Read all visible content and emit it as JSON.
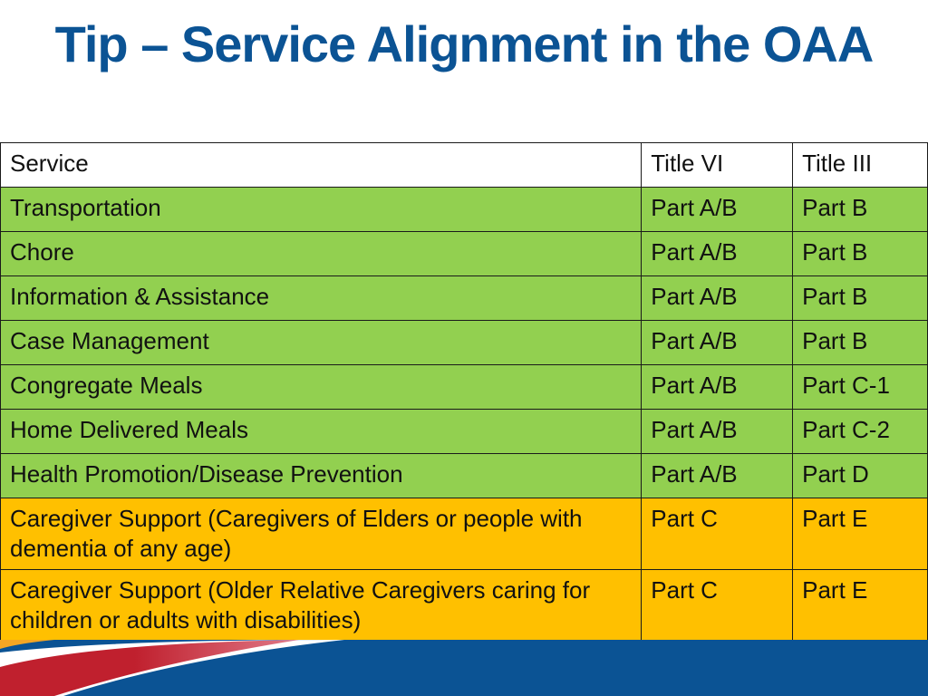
{
  "title": "Tip – Service Alignment in the OAA",
  "table": {
    "headers": [
      "Service",
      "Title VI",
      "Title III"
    ],
    "rows": [
      {
        "service": "Transportation",
        "title_vi": "Part A/B",
        "title_iii": "Part B",
        "color": "green"
      },
      {
        "service": "Chore",
        "title_vi": "Part A/B",
        "title_iii": "Part B",
        "color": "green"
      },
      {
        "service": "Information & Assistance",
        "title_vi": "Part A/B",
        "title_iii": "Part B",
        "color": "green"
      },
      {
        "service": "Case Management",
        "title_vi": "Part A/B",
        "title_iii": "Part B",
        "color": "green"
      },
      {
        "service": "Congregate Meals",
        "title_vi": "Part A/B",
        "title_iii": "Part C-1",
        "color": "green"
      },
      {
        "service": "Home Delivered Meals",
        "title_vi": "Part A/B",
        "title_iii": "Part C-2",
        "color": "green"
      },
      {
        "service": "Health Promotion/Disease Prevention",
        "title_vi": "Part A/B",
        "title_iii": "Part D",
        "color": "green"
      },
      {
        "service": "Caregiver Support (Caregivers of Elders or people with dementia of any age)",
        "title_vi": "Part C",
        "title_iii": "Part E",
        "color": "amber"
      },
      {
        "service": "Caregiver Support (Older Relative Caregivers caring for children or adults with disabilities)",
        "title_vi": "Part C",
        "title_iii": "Part E",
        "color": "amber"
      }
    ]
  },
  "colors": {
    "title": "#0b5394",
    "green_row": "#92d050",
    "amber_row": "#ffc000",
    "footer_blue": "#0b5394",
    "footer_red": "#c0202e"
  }
}
